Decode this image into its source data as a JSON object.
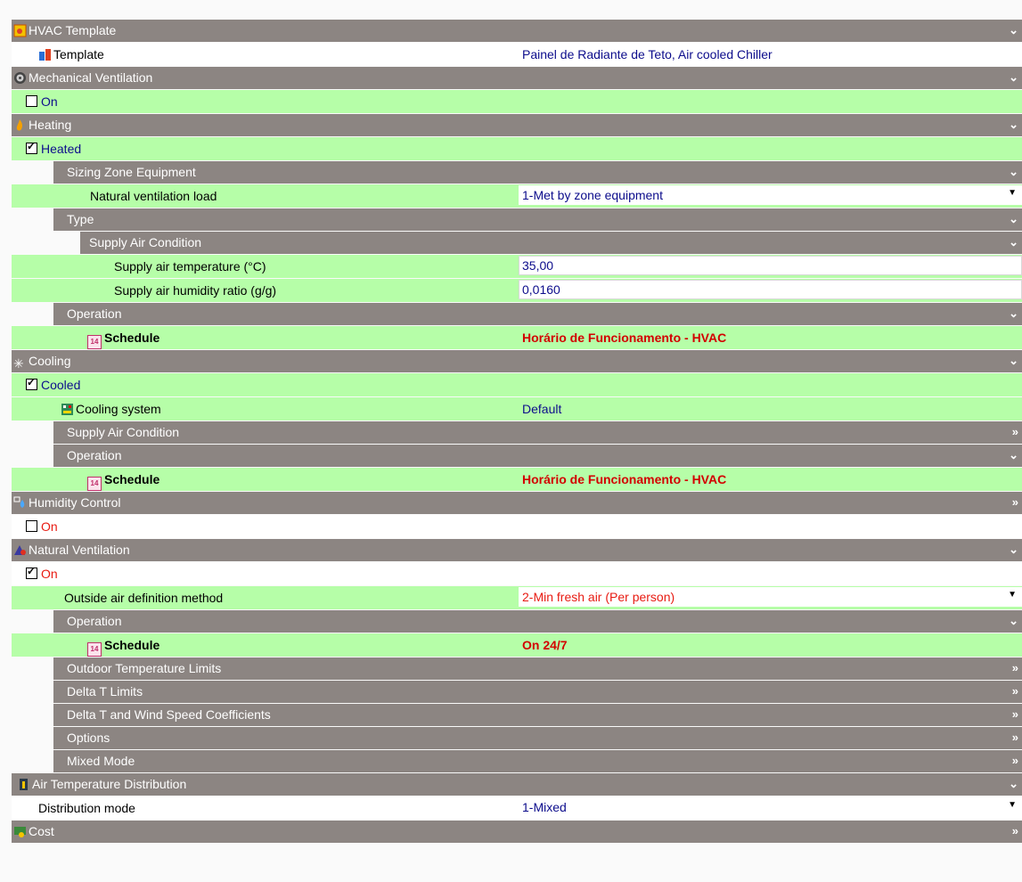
{
  "hvac_template": {
    "title": "HVAC Template",
    "template_label": "Template",
    "template_value": "Painel de Radiante de Teto, Air cooled Chiller"
  },
  "mechanical_ventilation": {
    "title": "Mechanical Ventilation",
    "on_label": "On",
    "on_checked": false
  },
  "heating": {
    "title": "Heating",
    "heated_label": "Heated",
    "heated_checked": true,
    "sizing": {
      "title": "Sizing Zone Equipment",
      "nat_vent_label": "Natural ventilation load",
      "nat_vent_value": "1-Met by zone equipment"
    },
    "type": {
      "title": "Type"
    },
    "supply_air": {
      "title": "Supply Air Condition",
      "temp_label": "Supply air temperature (°C)",
      "temp_value": "35,00",
      "humidity_label": "Supply air humidity ratio (g/g)",
      "humidity_value": "0,0160"
    },
    "operation": {
      "title": "Operation",
      "schedule_label": "Schedule",
      "schedule_value": "Horário de Funcionamento - HVAC"
    }
  },
  "cooling": {
    "title": "Cooling",
    "cooled_label": "Cooled",
    "cooled_checked": true,
    "system_label": "Cooling system",
    "system_value": "Default",
    "supply_air_title": "Supply Air Condition",
    "operation_title": "Operation",
    "schedule_label": "Schedule",
    "schedule_value": "Horário de Funcionamento - HVAC"
  },
  "humidity_control": {
    "title": "Humidity Control",
    "on_label": "On",
    "on_checked": false
  },
  "natural_ventilation": {
    "title": "Natural Ventilation",
    "on_label": "On",
    "on_checked": true,
    "method_label": "Outside air definition method",
    "method_value": "2-Min fresh air (Per person)",
    "operation_title": "Operation",
    "schedule_label": "Schedule",
    "schedule_value": "On 24/7",
    "outdoor_limits": "Outdoor Temperature Limits",
    "delta_t_limits": "Delta T Limits",
    "delta_t_wind": "Delta T and Wind Speed Coefficients",
    "options": "Options",
    "mixed_mode": "Mixed Mode"
  },
  "air_temp_dist": {
    "title": "Air Temperature Distribution",
    "mode_label": "Distribution mode",
    "mode_value": "1-Mixed"
  },
  "cost": {
    "title": "Cost"
  },
  "glyphs": {
    "expanded": "»",
    "collapsed": "»"
  },
  "colors": {
    "header": "#8c8582",
    "green_row": "#b6fea8",
    "value_blue": "#0d0d8c",
    "value_red": "#d30000"
  }
}
